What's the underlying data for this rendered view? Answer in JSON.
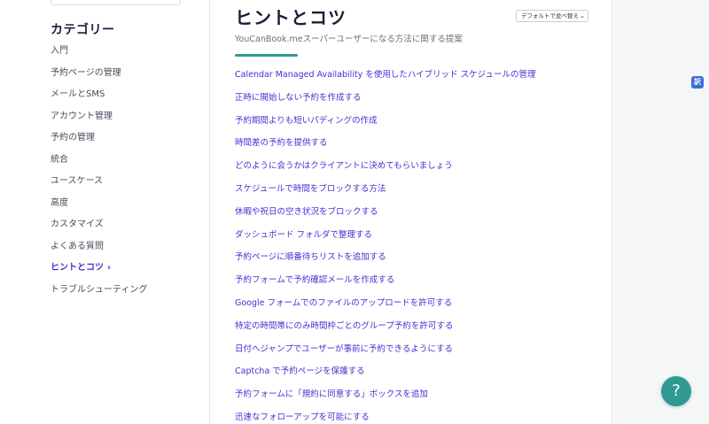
{
  "sidebar": {
    "heading": "カテゴリー",
    "items": [
      {
        "label": "入門"
      },
      {
        "label": "予約ページの管理"
      },
      {
        "label": "メールとSMS"
      },
      {
        "label": "アカウント管理"
      },
      {
        "label": "予約の管理"
      },
      {
        "label": "統合"
      },
      {
        "label": "ユースケース"
      },
      {
        "label": "高度"
      },
      {
        "label": "カスタマイズ"
      },
      {
        "label": "よくある質問"
      },
      {
        "label": "ヒントとコツ",
        "active": true
      },
      {
        "label": "トラブルシューティング"
      }
    ]
  },
  "main": {
    "title": "ヒントとコツ",
    "subtitle": "YouCanBook.meスーパーユーザーになる方法に関する提案",
    "sort": {
      "selected": "デフォルトで並べ替え"
    },
    "articles": [
      "Calendar Managed Availability を使用したハイブリッド スケジュールの管理",
      "正時に開始しない予約を作成する",
      "予約期間よりも短いパディングの作成",
      "時間差の予約を提供する",
      "どのように会うかはクライアントに決めてもらいましょう",
      "スケジュールで時間をブロックする方法",
      "休暇や祝日の空き状況をブロックする",
      "ダッシュボード フォルダで整理する",
      "予約ページに順番待ちリストを追加する",
      "予約フォームで予約確認メールを作成する",
      "Google フォームでのファイルのアップロードを許可する",
      "特定の時間帯にのみ時間枠ごとのグループ予約を許可する",
      "日付へジャンプでユーザーが事前に予約できるようにする",
      "Captcha で予約ページを保護する",
      "予約フォームに「規約に同意する」ボックスを追加",
      "迅速なフォローアップを可能にする"
    ]
  },
  "icons": {
    "translate": "translate-icon",
    "help": "question-mark-icon",
    "chevron": "chevron-right-icon"
  },
  "help_button": {
    "label": "?"
  },
  "colors": {
    "accent": "#2e9a92",
    "link": "#4b2bd1"
  }
}
